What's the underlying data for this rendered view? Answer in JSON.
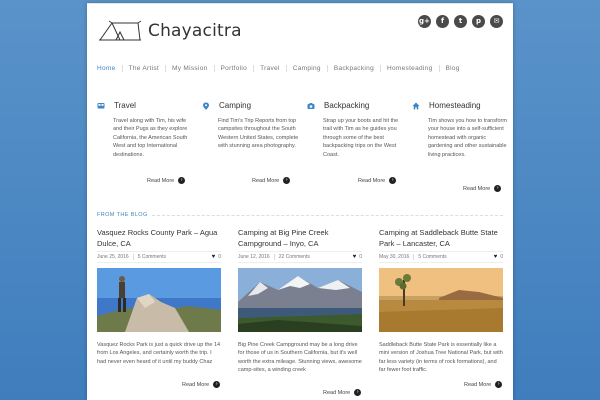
{
  "site": {
    "title": "Chayacitra"
  },
  "social": [
    {
      "name": "google-plus-icon",
      "glyph": "g+"
    },
    {
      "name": "facebook-icon",
      "glyph": "f"
    },
    {
      "name": "twitter-icon",
      "glyph": "t"
    },
    {
      "name": "pinterest-icon",
      "glyph": "p"
    },
    {
      "name": "email-icon",
      "glyph": "✉"
    }
  ],
  "nav": {
    "home": "Home",
    "artist": "The Artist",
    "mission": "My Mission",
    "portfolio": "Portfolio",
    "travel": "Travel",
    "camping": "Camping",
    "backpacking": "Backpacking",
    "homesteading": "Homesteading",
    "blog": "Blog"
  },
  "features": [
    {
      "title": "Travel",
      "icon": "bus-icon",
      "description": "Travel along with Tim, his wife and their Pugs as they explore California, the American South West and top International destinations.",
      "read_more": "Read More"
    },
    {
      "title": "Camping",
      "icon": "map-pin-icon",
      "description": "Find Tim's Trip Reports from top campsites throughout the South Western United States, complete with stunning area photography.",
      "read_more": "Read More"
    },
    {
      "title": "Backpacking",
      "icon": "camera-icon",
      "description": "Strap up your boots and hit the trail with Tim as he guides you through some of the best backpacking trips on the West Coast.",
      "read_more": "Read More"
    },
    {
      "title": "Homesteading",
      "icon": "home-icon",
      "description": "Tim shows you how to transform your house into a self-sufficient homestead with organic gardening and other sustainable living practices.",
      "read_more": "Read More"
    }
  ],
  "blog": {
    "heading": "FROM THE BLOG",
    "posts": [
      {
        "title": "Vasquez Rocks County Park – Agua Dulce, CA",
        "date": "June 25, 2016",
        "comments": "5 Comments",
        "likes": "0",
        "excerpt": "Vasquez Rocks Park is just a quick drive up the 14 from Los Angeles, and certainly worth the trip. I had never even heard of it until my buddy Chaz",
        "read_more": "Read More"
      },
      {
        "title": "Camping at Big Pine Creek Campground – Inyo, CA",
        "date": "June 12, 2016",
        "comments": "22 Comments",
        "likes": "0",
        "excerpt": "Big Pine Creek Campground may be a long drive for those of us in Southern California, but it's well worth the extra mileage. Stunning views, awesome camp-sites, a winding creek",
        "read_more": "Read More"
      },
      {
        "title": "Camping at Saddleback Butte State Park – Lancaster, CA",
        "date": "May 30, 2016",
        "comments": "5 Comments",
        "likes": "0",
        "excerpt": "Saddleback Butte State Park is essentially like a mini version of Joshua Tree National Park, but with far less variety (in terms of rock formations), and far fewer foot traffic.",
        "read_more": "Read More"
      }
    ]
  },
  "colors": {
    "accent": "#3f86c5",
    "background": "#4a88c6"
  }
}
